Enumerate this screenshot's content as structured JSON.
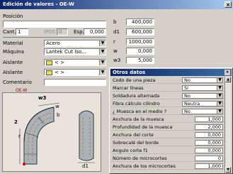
{
  "window": {
    "title": "Edición de valores - OE-W",
    "close": "×"
  },
  "form": {
    "posicion_label": "Posición",
    "posicion_value": "",
    "cant_label": "Cant.",
    "cant_value": "1",
    "ipos_label": "IPOS",
    "ipos_value": "0",
    "esp_label": "Esp.",
    "esp_value": "0,000",
    "material_label": "Material",
    "material_value": "Acero",
    "maquina_label": "Máquina",
    "maquina_value": "Lantek Cut Iso...",
    "aislante1_label": "Aislante",
    "aislante1_value": "< >",
    "aislante2_label": "Aislante",
    "aislante2_value": "< >",
    "comentario_label": "Comentario",
    "comentario_value": ""
  },
  "params": [
    {
      "label": "b",
      "value": "400,000"
    },
    {
      "label": "d1",
      "value": "600,000"
    },
    {
      "label": "r",
      "value": "1000,000"
    },
    {
      "label": "w",
      "value": "0,000"
    },
    {
      "label": "w3",
      "value": "5,000"
    }
  ],
  "drawing": {
    "title": "OE-W",
    "labels": {
      "w3": "w3",
      "w": "w",
      "b": "b",
      "r": "r",
      "d1": "d1",
      "two": "2"
    }
  },
  "dialog": {
    "title": "Otros datos",
    "close": "×",
    "rows": [
      {
        "label": "Codo de una pieza",
        "value": "No",
        "kind": "select"
      },
      {
        "label": "Marcar líneas",
        "value": "Sí",
        "kind": "select"
      },
      {
        "label": "Soldadura alternada",
        "value": "No",
        "kind": "select"
      },
      {
        "label": "Fibra cálculo cilindro",
        "value": "Neutra",
        "kind": "select"
      },
      {
        "label": "¿ Muesca en el medio ?",
        "value": "No",
        "kind": "select"
      },
      {
        "label": "Anchura de la muesca",
        "value": "1,000",
        "kind": "number"
      },
      {
        "label": "Profundidad de la muesca",
        "value": "2,000",
        "kind": "number"
      },
      {
        "label": "Anchura del corte",
        "value": "0,000",
        "kind": "number"
      },
      {
        "label": "Sobrecalé del borde",
        "value": "0,000",
        "kind": "number"
      },
      {
        "label": "Angulo corte f1",
        "value": "0,000",
        "kind": "number"
      },
      {
        "label": "Número de microcortes",
        "value": "0",
        "kind": "number"
      },
      {
        "label": "Anchura de los microcortes",
        "value": "1,000",
        "kind": "number"
      }
    ]
  },
  "colors": {
    "title_gradient_start": "#0a246a",
    "swatch": "#e8e04a"
  }
}
